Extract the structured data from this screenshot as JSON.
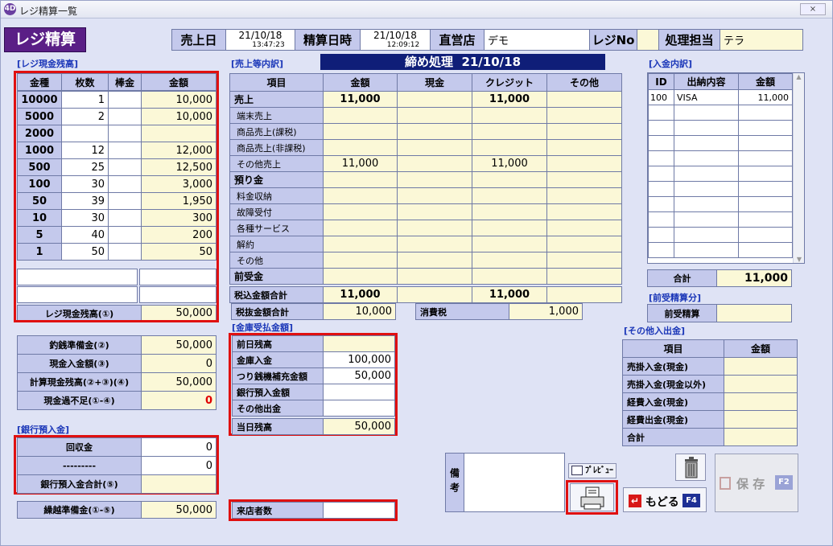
{
  "window": {
    "title": "レジ精算一覧",
    "app_icon": "4D",
    "close": "⨯"
  },
  "logo": "レジ精算",
  "header": {
    "uriagebi_label": "売上日",
    "uriagebi_date": "21/10/18",
    "uriagebi_time": "13:47:23",
    "seisan_label": "精算日時",
    "seisan_date": "21/10/18",
    "seisan_time": "12:09:12",
    "store_label": "直営店",
    "store_value": "デモ",
    "regino_label": "レジNo",
    "regino_value": "",
    "tanto_label": "処理担当",
    "tanto_value": "テラ"
  },
  "banner": {
    "label": "締め処理",
    "date": "21/10/18"
  },
  "cash": {
    "section": "[レジ現金残高]",
    "headers": [
      "金種",
      "枚数",
      "棒金",
      "金額"
    ],
    "rows": [
      {
        "kind": "10000",
        "count": "1",
        "bou": "",
        "amount": "10,000"
      },
      {
        "kind": "5000",
        "count": "2",
        "bou": "",
        "amount": "10,000"
      },
      {
        "kind": "2000",
        "count": "",
        "bou": "",
        "amount": ""
      },
      {
        "kind": "1000",
        "count": "12",
        "bou": "",
        "amount": "12,000"
      },
      {
        "kind": "500",
        "count": "25",
        "bou": "",
        "amount": "12,500"
      },
      {
        "kind": "100",
        "count": "30",
        "bou": "",
        "amount": "3,000"
      },
      {
        "kind": "50",
        "count": "39",
        "bou": "",
        "amount": "1,950"
      },
      {
        "kind": "10",
        "count": "30",
        "bou": "",
        "amount": "300"
      },
      {
        "kind": "5",
        "count": "40",
        "bou": "",
        "amount": "200"
      },
      {
        "kind": "1",
        "count": "50",
        "bou": "",
        "amount": "50"
      }
    ],
    "total_label": "レジ現金残高(①)",
    "total_value": "50,000"
  },
  "summary": {
    "rows": [
      {
        "label": "釣銭準備金(②)",
        "value": "50,000"
      },
      {
        "label": "現金入金額(③)",
        "value": "0"
      },
      {
        "label": "計算現金残高(②+③)(④)",
        "value": "50,000"
      },
      {
        "label": "現金過不足(①-④)",
        "value": "0"
      }
    ]
  },
  "bank": {
    "section": "[銀行預入金]",
    "rows": [
      {
        "label": "回収金",
        "value": "0"
      },
      {
        "label": "---------",
        "value": "0"
      },
      {
        "label": "銀行預入金合計(⑤)",
        "value": ""
      }
    ]
  },
  "kurikoshi": {
    "label": "繰越準備金(①-⑤)",
    "value": "50,000"
  },
  "sales": {
    "section": "[売上等内訳]",
    "headers": [
      "項目",
      "金額",
      "現金",
      "クレジット",
      "その他"
    ],
    "rows": [
      {
        "label": "売上",
        "amount": "11,000",
        "cash": "",
        "credit": "11,000",
        "other": "",
        "bold": true
      },
      {
        "label": "端末売上",
        "amount": "",
        "cash": "",
        "credit": "",
        "other": ""
      },
      {
        "label": "商品売上(課税)",
        "amount": "",
        "cash": "",
        "credit": "",
        "other": ""
      },
      {
        "label": "商品売上(非課税)",
        "amount": "",
        "cash": "",
        "credit": "",
        "other": ""
      },
      {
        "label": "その他売上",
        "amount": "11,000",
        "cash": "",
        "credit": "11,000",
        "other": ""
      },
      {
        "label": "預り金",
        "amount": "",
        "cash": "",
        "credit": "",
        "other": "",
        "bold": true
      },
      {
        "label": "料金収納",
        "amount": "",
        "cash": "",
        "credit": "",
        "other": ""
      },
      {
        "label": "故障受付",
        "amount": "",
        "cash": "",
        "credit": "",
        "other": ""
      },
      {
        "label": "各種サービス",
        "amount": "",
        "cash": "",
        "credit": "",
        "other": ""
      },
      {
        "label": "解約",
        "amount": "",
        "cash": "",
        "credit": "",
        "other": ""
      },
      {
        "label": "その他",
        "amount": "",
        "cash": "",
        "credit": "",
        "other": ""
      },
      {
        "label": "前受金",
        "amount": "",
        "cash": "",
        "credit": "",
        "other": "",
        "bold": true
      }
    ],
    "total": {
      "label": "税込金額合計",
      "amount": "11,000",
      "credit": "11,000"
    },
    "zeinuki_label": "税抜金額合計",
    "zeinuki_value": "10,000",
    "tax_label": "消費税",
    "tax_value": "1,000"
  },
  "kinko": {
    "section": "[金庫受払金額]",
    "rows": [
      {
        "label": "前日残高",
        "value": ""
      },
      {
        "label": "金庫入金",
        "value": "100,000"
      },
      {
        "label": "つり銭機補充金額",
        "value": "50,000"
      },
      {
        "label": "銀行預入金額",
        "value": ""
      },
      {
        "label": "その他出金",
        "value": ""
      }
    ],
    "total_label": "当日残高",
    "total_value": "50,000"
  },
  "raiten": {
    "label": "来店者数",
    "value": ""
  },
  "nyukin": {
    "section": "[入金内訳]",
    "headers": [
      "ID",
      "出納内容",
      "金額"
    ],
    "rows": [
      {
        "id": "100",
        "content": "VISA",
        "amount": "11,000"
      }
    ],
    "total_label": "合計",
    "total_value": "11,000"
  },
  "maeuke": {
    "section": "[前受精算分]",
    "label": "前受精算",
    "value": ""
  },
  "sonota": {
    "section": "[その他入出金]",
    "headers": [
      "項目",
      "金額"
    ],
    "rows": [
      "売掛入金(現金)",
      "売掛入金(現金以外)",
      "経費入金(現金)",
      "経費出金(現金)",
      "合計"
    ]
  },
  "biko_label": "備考",
  "buttons": {
    "preview": "ﾌﾟﾚﾋﾞｭｰ",
    "modoru": "もどる",
    "modoru_key": "F4",
    "save": "保 存",
    "save_key": "F2"
  }
}
